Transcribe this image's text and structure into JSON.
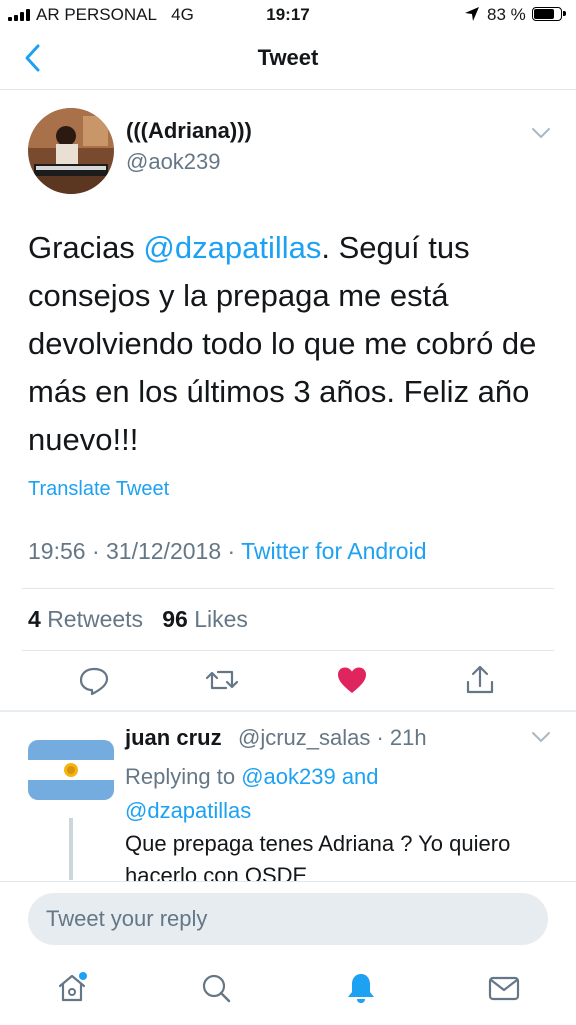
{
  "status_bar": {
    "carrier": "AR PERSONAL",
    "network": "4G",
    "time": "19:17",
    "battery": "83 %",
    "battery_level": 0.83
  },
  "nav": {
    "title": "Tweet",
    "back_icon": "chevron-left-icon"
  },
  "tweet": {
    "display_name": "(((Adriana)))",
    "handle": "@aok239",
    "text_before": "Gracias ",
    "mention": "@dzapatillas",
    "text_after": ". Seguí tus consejos y la prepaga me está devolviendo todo lo que me cobró de más en los últimos 3 años. Feliz año nuevo!!!",
    "translate": "Translate Tweet",
    "timestamp": "19:56 · 31/12/2018 · ",
    "source": "Twitter for Android",
    "retweets_count": "4",
    "retweets_label": "Retweets",
    "likes_count": "96",
    "likes_label": "Likes",
    "actions": [
      "reply-icon",
      "retweet-icon",
      "like-icon",
      "share-icon"
    ],
    "liked": true
  },
  "reply": {
    "display_name": "juan cruz",
    "handle_time": "@jcruz_salas · 21h",
    "replying_prefix": "Replying to ",
    "replying_user1": "@aok239",
    "replying_and": " and",
    "replying_user2": "@dzapatillas",
    "text": "Que prepaga tenes Adriana ? Yo quiero hacerlo con OSDE"
  },
  "composer": {
    "placeholder": "Tweet your reply"
  },
  "tab_bar": {
    "tabs": [
      "home-icon",
      "search-icon",
      "notifications-icon",
      "messages-icon"
    ],
    "active": "notifications-icon"
  },
  "colors": {
    "accent": "#1da1f2",
    "like": "#e0245e",
    "secondary_text": "#657786",
    "divider": "#e1e8ed"
  }
}
